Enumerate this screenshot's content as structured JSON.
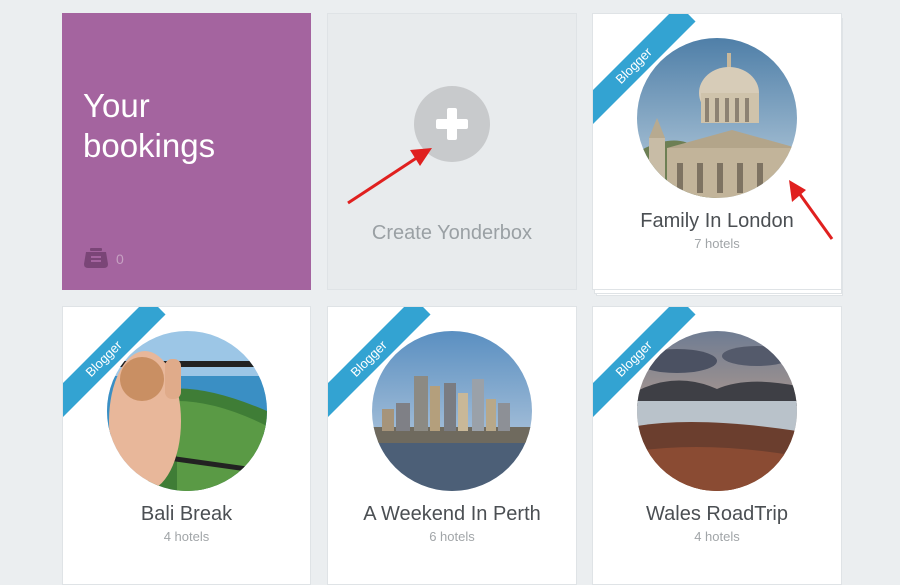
{
  "bookings": {
    "title": "Your bookings",
    "count": "0",
    "icon": "inbox-icon"
  },
  "create": {
    "label": "Create Yonderbox",
    "icon": "plus-icon"
  },
  "ribbon_label": "Blogger",
  "boxes": [
    {
      "title": "Family In London",
      "subtitle": "7 hotels",
      "photo": "st-pauls-cathedral"
    },
    {
      "title": "Bali Break",
      "subtitle": "4 hotels",
      "photo": "child-on-balcony-coast"
    },
    {
      "title": "A Weekend In Perth",
      "subtitle": "6 hotels",
      "photo": "perth-skyline"
    },
    {
      "title": "Wales RoadTrip",
      "subtitle": "4 hotels",
      "photo": "welsh-lake-landscape"
    }
  ],
  "colors": {
    "bookings_tile": "#a4649f",
    "ribbon": "#33a3d2",
    "annotation_arrow": "#e0201f",
    "background": "#ebeef0"
  }
}
